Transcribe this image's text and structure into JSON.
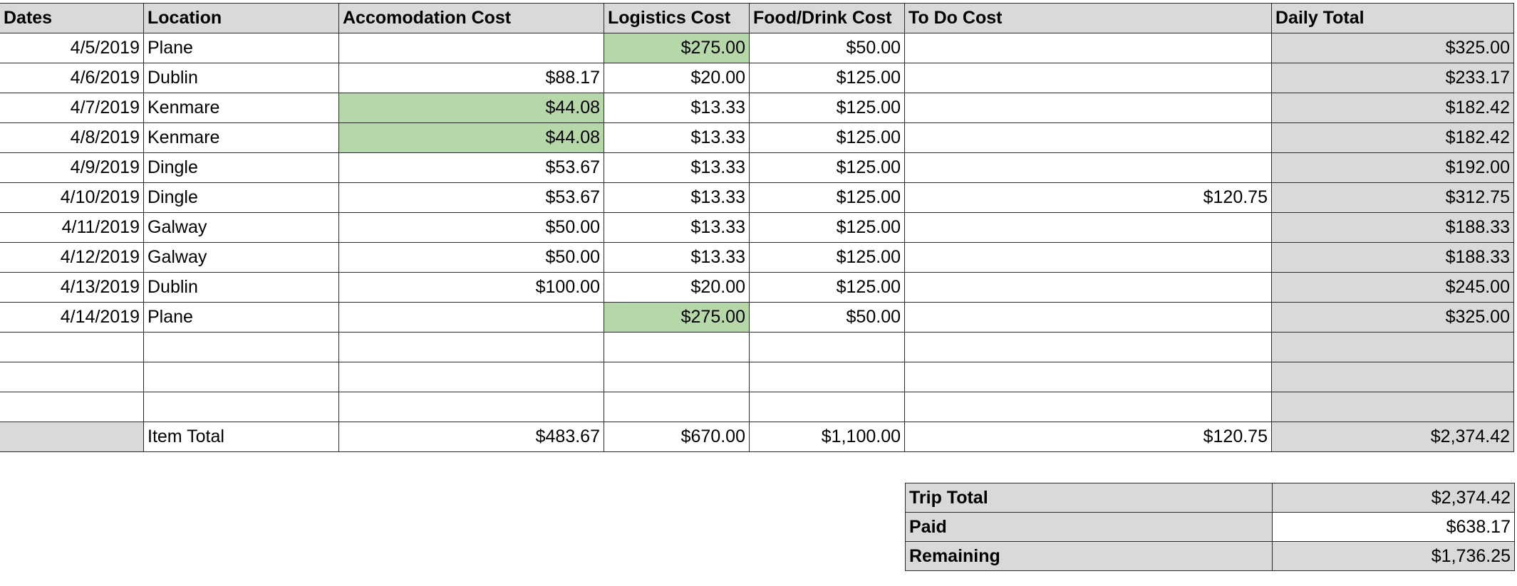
{
  "headers": {
    "dates": "Dates",
    "location": "Location",
    "accommodation": "Accomodation Cost",
    "logistics": "Logistics Cost",
    "food": "Food/Drink Cost",
    "todo": "To Do Cost",
    "daily": "Daily Total"
  },
  "rows": [
    {
      "date": "4/5/2019",
      "location": "Plane",
      "accommodation": "",
      "logistics": "$275.00",
      "food": "$50.00",
      "todo": "",
      "daily": "$325.00"
    },
    {
      "date": "4/6/2019",
      "location": "Dublin",
      "accommodation": "$88.17",
      "logistics": "$20.00",
      "food": "$125.00",
      "todo": "",
      "daily": "$233.17"
    },
    {
      "date": "4/7/2019",
      "location": "Kenmare",
      "accommodation": "$44.08",
      "logistics": "$13.33",
      "food": "$125.00",
      "todo": "",
      "daily": "$182.42"
    },
    {
      "date": "4/8/2019",
      "location": "Kenmare",
      "accommodation": "$44.08",
      "logistics": "$13.33",
      "food": "$125.00",
      "todo": "",
      "daily": "$182.42"
    },
    {
      "date": "4/9/2019",
      "location": "Dingle",
      "accommodation": "$53.67",
      "logistics": "$13.33",
      "food": "$125.00",
      "todo": "",
      "daily": "$192.00"
    },
    {
      "date": "4/10/2019",
      "location": "Dingle",
      "accommodation": "$53.67",
      "logistics": "$13.33",
      "food": "$125.00",
      "todo": "$120.75",
      "daily": "$312.75"
    },
    {
      "date": "4/11/2019",
      "location": "Galway",
      "accommodation": "$50.00",
      "logistics": "$13.33",
      "food": "$125.00",
      "todo": "",
      "daily": "$188.33"
    },
    {
      "date": "4/12/2019",
      "location": "Galway",
      "accommodation": "$50.00",
      "logistics": "$13.33",
      "food": "$125.00",
      "todo": "",
      "daily": "$188.33"
    },
    {
      "date": "4/13/2019",
      "location": "Dublin",
      "accommodation": "$100.00",
      "logistics": "$20.00",
      "food": "$125.00",
      "todo": "",
      "daily": "$245.00"
    },
    {
      "date": "4/14/2019",
      "location": "Plane",
      "accommodation": "",
      "logistics": "$275.00",
      "food": "$50.00",
      "todo": "",
      "daily": "$325.00"
    }
  ],
  "totals": {
    "label": "Item Total",
    "accommodation": "$483.67",
    "logistics": "$670.00",
    "food": "$1,100.00",
    "todo": "$120.75",
    "daily": "$2,374.42"
  },
  "summary": {
    "trip_total_label": "Trip Total",
    "trip_total_value": "$2,374.42",
    "paid_label": "Paid",
    "paid_value": "$638.17",
    "remaining_label": "Remaining",
    "remaining_value": "$1,736.25"
  },
  "colors": {
    "header_grey": "#d9d9d9",
    "highlight_green": "#b6d7a8"
  }
}
